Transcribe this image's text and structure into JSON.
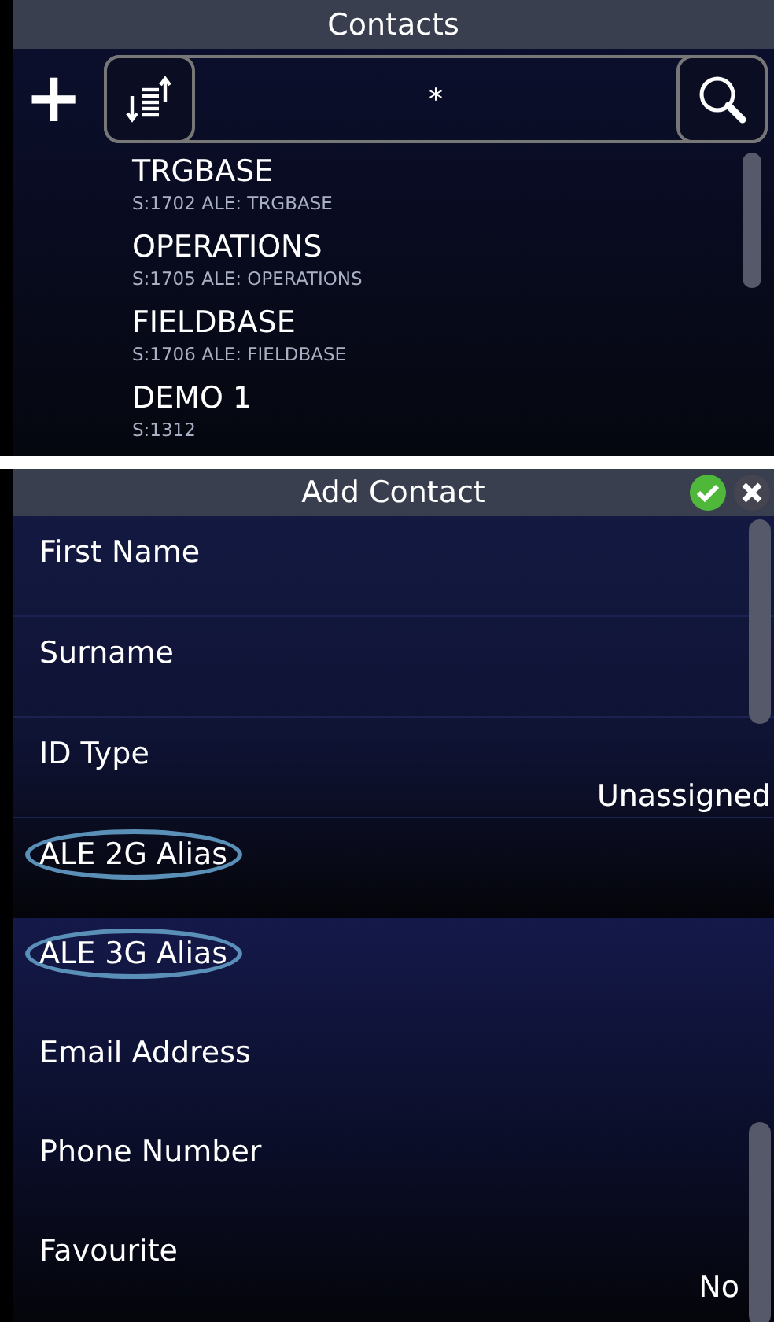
{
  "contacts": {
    "title": "Contacts",
    "add_button": "+",
    "search": {
      "value": "*"
    },
    "items": [
      {
        "name": "TRGBASE",
        "detail": "S:1702  ALE: TRGBASE"
      },
      {
        "name": "OPERATIONS",
        "detail": "S:1705  ALE: OPERATIONS"
      },
      {
        "name": "FIELDBASE",
        "detail": "S:1706  ALE: FIELDBASE"
      },
      {
        "name": "DEMO 1",
        "detail": "S:1312"
      }
    ]
  },
  "add_contact": {
    "title": "Add Contact",
    "fields": [
      {
        "label": "First Name",
        "highlighted": false
      },
      {
        "label": "Surname",
        "highlighted": false
      },
      {
        "label": "ID Type",
        "value": "Unassigned",
        "highlighted": false
      },
      {
        "label": "ALE 2G Alias",
        "highlighted": true
      }
    ]
  },
  "add_contact_continued": {
    "fields": [
      {
        "label": "ALE 3G Alias",
        "highlighted": true
      },
      {
        "label": "Email Address",
        "highlighted": false
      },
      {
        "label": "Phone Number",
        "highlighted": false
      },
      {
        "label": "Favourite",
        "value": "No",
        "highlighted": false
      }
    ]
  }
}
